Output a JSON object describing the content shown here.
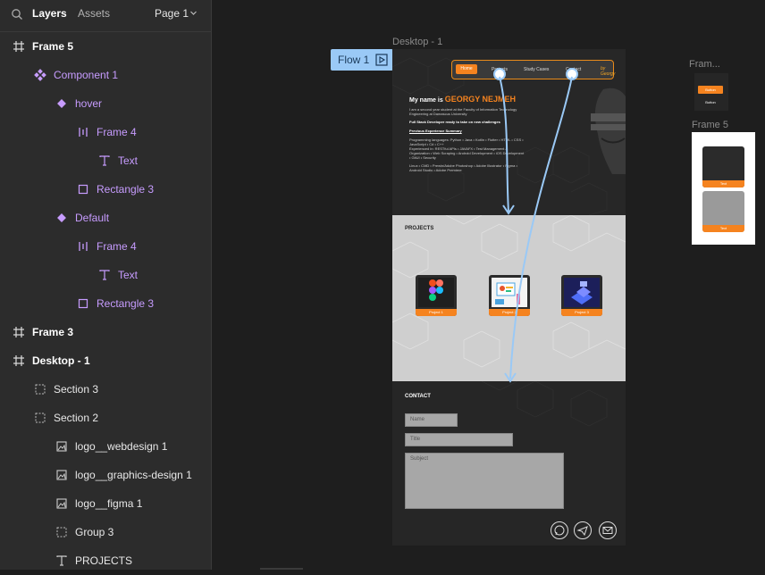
{
  "topbar": {
    "layers_tab": "Layers",
    "assets_tab": "Assets",
    "page_selector": "Page 1"
  },
  "layers": [
    {
      "label": "Frame 5",
      "type": "frame",
      "indent": 0,
      "style": "bold"
    },
    {
      "label": "Component 1",
      "type": "component",
      "indent": 1,
      "style": "purple"
    },
    {
      "label": "hover",
      "type": "variant",
      "indent": 2,
      "style": "purple"
    },
    {
      "label": "Frame 4",
      "type": "autolayout",
      "indent": 3,
      "style": "purple"
    },
    {
      "label": "Text",
      "type": "text",
      "indent": 4,
      "style": "purple"
    },
    {
      "label": "Rectangle 3",
      "type": "rectangle",
      "indent": 3,
      "style": "purple"
    },
    {
      "label": "Default",
      "type": "variant",
      "indent": 2,
      "style": "purple"
    },
    {
      "label": "Frame 4",
      "type": "autolayout",
      "indent": 3,
      "style": "purple"
    },
    {
      "label": "Text",
      "type": "text",
      "indent": 4,
      "style": "purple"
    },
    {
      "label": "Rectangle 3",
      "type": "rectangle",
      "indent": 3,
      "style": "purple"
    },
    {
      "label": "Frame 3",
      "type": "frame",
      "indent": 0,
      "style": "bold"
    },
    {
      "label": "Desktop - 1",
      "type": "frame",
      "indent": 0,
      "style": "bold"
    },
    {
      "label": "Section 3",
      "type": "section",
      "indent": 1,
      "style": "white"
    },
    {
      "label": "Section 2",
      "type": "section",
      "indent": 1,
      "style": "white"
    },
    {
      "label": "logo__webdesign 1",
      "type": "image",
      "indent": 2,
      "style": "white"
    },
    {
      "label": "logo__graphics-design 1",
      "type": "image",
      "indent": 2,
      "style": "white"
    },
    {
      "label": "logo__figma 1",
      "type": "image",
      "indent": 2,
      "style": "white"
    },
    {
      "label": "Group 3",
      "type": "group",
      "indent": 2,
      "style": "white"
    },
    {
      "label": "PROJECTS",
      "type": "text",
      "indent": 2,
      "style": "white"
    }
  ],
  "canvas": {
    "desktop_label": "Desktop - 1",
    "flow_label": "Flow 1",
    "frame_mini_label": "Fram...",
    "frame5_label": "Frame 5"
  },
  "desktop": {
    "nav": {
      "home": "Home",
      "projects": "Projects",
      "case": "Study Cases",
      "contact": "Contact",
      "logo": "by Georgy"
    },
    "hero": {
      "intro": "My name is ",
      "name": "GEORGY NEJMEH",
      "line1": "I am a second year student at the Faculty of Information Technology",
      "line2": "Engineering at Damascus University",
      "sub1": "Full Stack Developer ready to take on new challenges",
      "sub2": "Previous Experience Summary",
      "p1": "Programming languages: Python • Java • Kotlin • Flutter • HTML • CSS •",
      "p2": "JavaScript • C# • C++",
      "p3": "Experienced in: RESTful APIs • JAVAFX • Test Management &",
      "p4": "Organization • Web Scraping • Android Development • iOS Development",
      "p5": "• GitUI • Security",
      "p6": "Linux • CMD • Prewin/Adobe Photoshop • Adobe Illustrator • Figma •",
      "p7": "Android Studio • Adobe Premiere"
    },
    "projects": {
      "title": "PROJECTS",
      "items": [
        "Project 1",
        "Project 2",
        "Project 3"
      ]
    },
    "contact": {
      "title": "CONTACT",
      "name_ph": "Name",
      "title_ph": "Title",
      "subject_ph": "Subject"
    }
  },
  "frame_mini": {
    "btn1": "Button",
    "btn2": "Button"
  },
  "frame5": {
    "card1": "Text",
    "card2": "Text"
  },
  "colors": {
    "accent": "#f5831f",
    "prototype": "#9ac9f6",
    "layer_purple": "#c79cff"
  }
}
